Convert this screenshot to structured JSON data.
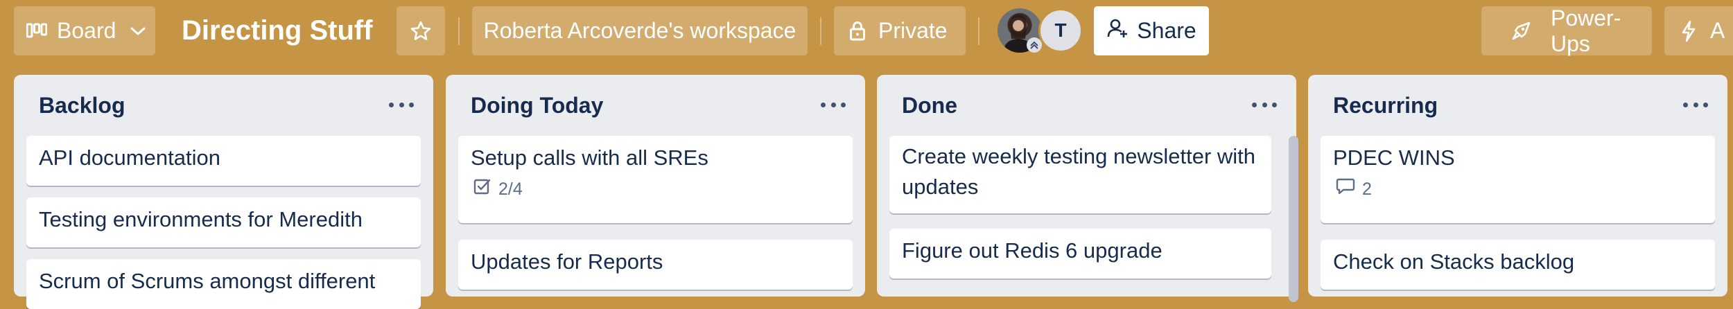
{
  "header": {
    "view_switcher_label": "Board",
    "board_title": "Directing Stuff",
    "workspace_label": "Roberta Arcoverde's workspace",
    "visibility_label": "Private",
    "member_initial": "T",
    "share_label": "Share",
    "powerups_label": "Power-Ups",
    "automation_label_partial": "A"
  },
  "lists": [
    {
      "title": "Backlog",
      "cards": [
        {
          "title": "API documentation"
        },
        {
          "title": "Testing environments for Meredith"
        },
        {
          "title": "Scrum of Scrums amongst different"
        }
      ]
    },
    {
      "title": "Doing Today",
      "cards": [
        {
          "title": "Setup calls with all SREs",
          "checklist": "2/4"
        },
        {
          "title": "Updates for Reports"
        }
      ]
    },
    {
      "title": "Done",
      "cards": [
        {
          "title_line1": "Create weekly testing newsletter with",
          "title_line2": "updates"
        },
        {
          "title": "Figure out Redis 6 upgrade"
        }
      ]
    },
    {
      "title": "Recurring",
      "cards": [
        {
          "title": "PDEC WINS",
          "comments": "2"
        },
        {
          "title": "Check on Stacks backlog"
        }
      ]
    }
  ],
  "colors": {
    "board_background": "#c69445",
    "list_background": "#ebecf0",
    "card_background": "#ffffff",
    "text_primary": "#172b4d"
  }
}
